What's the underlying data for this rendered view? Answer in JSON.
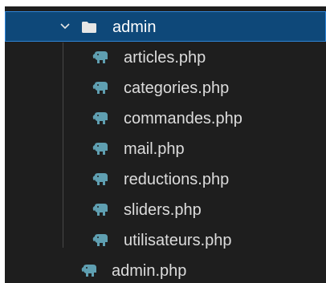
{
  "explorer": {
    "folder": {
      "name": "admin",
      "expanded": true,
      "icon": "folder-icon"
    },
    "children": [
      {
        "name": "articles.php",
        "icon": "php-elephant-icon"
      },
      {
        "name": "categories.php",
        "icon": "php-elephant-icon"
      },
      {
        "name": "commandes.php",
        "icon": "php-elephant-icon"
      },
      {
        "name": "mail.php",
        "icon": "php-elephant-icon"
      },
      {
        "name": "reductions.php",
        "icon": "php-elephant-icon"
      },
      {
        "name": "sliders.php",
        "icon": "php-elephant-icon"
      },
      {
        "name": "utilisateurs.php",
        "icon": "php-elephant-icon"
      }
    ],
    "sibling": {
      "name": "admin.php",
      "icon": "php-elephant-icon"
    }
  },
  "colors": {
    "background": "#1e1e1e",
    "selection": "#0e4879",
    "selection_border": "#2f84d6",
    "text": "#dcdcdc",
    "php_icon": "#5f9fb1"
  }
}
